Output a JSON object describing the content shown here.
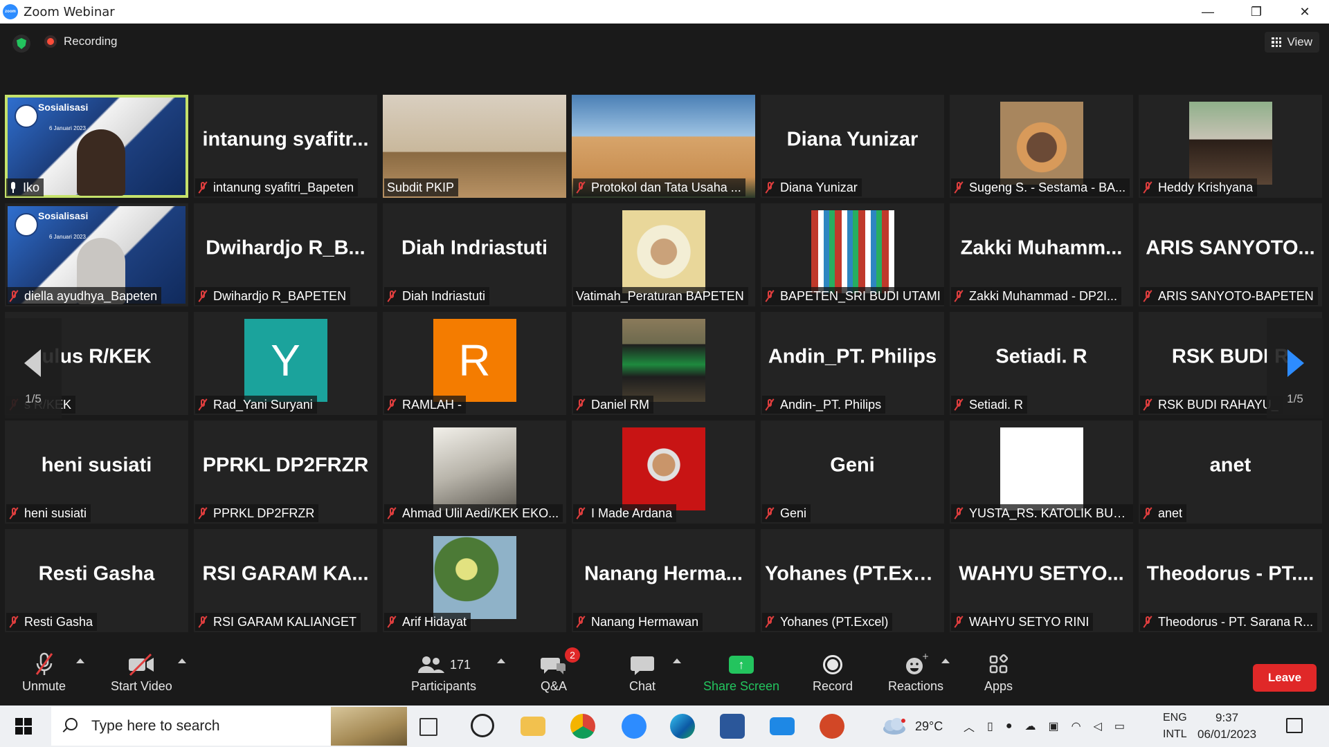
{
  "window": {
    "title": "Zoom Webinar",
    "controls": [
      "—",
      "❐",
      "✕"
    ]
  },
  "topbar": {
    "recording_label": "Recording",
    "view_label": "View"
  },
  "tiles": [
    {
      "big": "",
      "label": "Iko",
      "banner": true,
      "banner_title": "Sosialisasi",
      "banner_date": "6 Januari 2023",
      "active": true,
      "mic": "on"
    },
    {
      "big": "intanung  syafitr...",
      "label": "intanung syafitri_Bapeten"
    },
    {
      "big": "",
      "label": "Subdit PKIP",
      "photo": "room",
      "nomic": true
    },
    {
      "big": "",
      "label": "Protokol dan Tata Usaha ...",
      "photo": "building"
    },
    {
      "big": "Diana Yunizar",
      "label": "Diana Yunizar"
    },
    {
      "big": "",
      "label": "Sugeng S. - Sestama - BA...",
      "photo": "portrait"
    },
    {
      "big": "",
      "label": "Heddy Krishyana",
      "photo": "portrait2"
    },
    {
      "big": "",
      "label": "diella ayudhya_Bapeten",
      "banner": true,
      "banner_title": "Sosialisasi",
      "banner_date": "6 Januari 2023",
      "hijab": true
    },
    {
      "big": "Dwihardjo R_B...",
      "label": "Dwihardjo R_BAPETEN"
    },
    {
      "big": "Diah Indriastuti",
      "label": "Diah Indriastuti"
    },
    {
      "big": "",
      "label": "Vatimah_Peraturan BAPETEN",
      "photo": "hijabportrait",
      "nomic": true
    },
    {
      "big": "",
      "label": "BAPETEN_SRI BUDI UTAMI",
      "photo": "flags"
    },
    {
      "big": "Zakki  Muhamm...",
      "label": "Zakki Muhammad - DP2I..."
    },
    {
      "big": "ARIS  SANYOTO...",
      "label": "ARIS SANYOTO-BAPETEN"
    },
    {
      "big": "ulus R/KEK",
      "label": "s R/KEK"
    },
    {
      "big": "",
      "label": "Rad_Yani Suryani",
      "letter": "Y",
      "letter_color": "#1ba39c"
    },
    {
      "big": "",
      "label": "RAMLAH -",
      "letter": "R",
      "letter_color": "#f47c00"
    },
    {
      "big": "",
      "label": "Daniel RM",
      "photo": "standing"
    },
    {
      "big": "Andin_PT. Philips",
      "label": "Andin-_PT. Philips"
    },
    {
      "big": "Setiadi. R",
      "label": "Setiadi. R"
    },
    {
      "big": "RSK BUDI R",
      "label": "RSK BUDI RAHAYU_"
    },
    {
      "big": "heni susiati",
      "label": "heni susiati"
    },
    {
      "big": "PPRKL DP2FRZR",
      "label": "PPRKL DP2FRZR"
    },
    {
      "big": "",
      "label": "Ahmad Ulil Aedi/KEK EKO...",
      "photo": "bw"
    },
    {
      "big": "",
      "label": "I Made Ardana",
      "photo": "redbg"
    },
    {
      "big": "Geni",
      "label": "Geni"
    },
    {
      "big": "",
      "label": "YUSTA_RS. KATOLIK BUDI ...",
      "photo": "xray"
    },
    {
      "big": "anet",
      "label": "anet"
    },
    {
      "big": "Resti Gasha",
      "label": "Resti Gasha"
    },
    {
      "big": "RSI  GARAM  KA...",
      "label": "RSI GARAM KALIANGET"
    },
    {
      "big": "",
      "label": "Arif Hidayat",
      "photo": "tree"
    },
    {
      "big": "Nanang  Herma...",
      "label": "Nanang Hermawan"
    },
    {
      "big": "Yohanes  (PT.Exc...",
      "label": "Yohanes (PT.Excel)"
    },
    {
      "big": "WAHYU  SETYO...",
      "label": "WAHYU SETYO RINI"
    },
    {
      "big": "Theodorus  -  PT....",
      "label": "Theodorus - PT. Sarana R..."
    }
  ],
  "pagination": {
    "left": "1/5",
    "right": "1/5"
  },
  "toolbar": {
    "unmute": "Unmute",
    "start_video": "Start Video",
    "participants_count": "171",
    "participants": "Participants",
    "qa": "Q&A",
    "qa_badge": "2",
    "chat": "Chat",
    "share_screen": "Share Screen",
    "record": "Record",
    "reactions": "Reactions",
    "apps": "Apps",
    "leave": "Leave"
  },
  "taskbar": {
    "search_placeholder": "Type here to search",
    "weather": "29°C",
    "lang_top": "ENG",
    "lang_bottom": "INTL",
    "time": "9:37",
    "date": "06/01/2023"
  },
  "colors": {
    "share_green": "#23c45e",
    "leave_red": "#e02828",
    "active_speaker": "#c5e26b",
    "zoom_blue": "#2d8cff"
  }
}
